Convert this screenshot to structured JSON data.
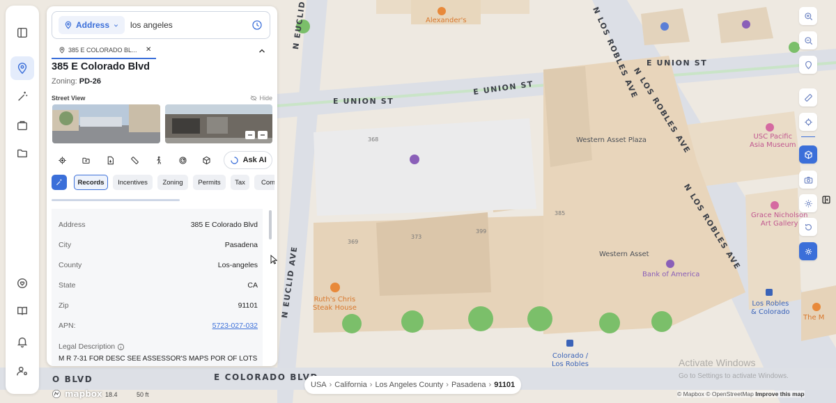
{
  "search": {
    "type_label": "Address",
    "value": "los angeles"
  },
  "tab": {
    "label": "385 E COLORADO BL..."
  },
  "property": {
    "title": "385 E Colorado Blvd",
    "zoning_label": "Zoning:",
    "zoning_value": "PD-26",
    "street_view_label": "Street View",
    "hide_label": "Hide",
    "ask_ai": "Ask AI"
  },
  "chips": [
    "Records",
    "Incentives",
    "Zoning",
    "Permits",
    "Tax",
    "Com"
  ],
  "records": [
    {
      "k": "Address",
      "v": "385 E Colorado Blvd"
    },
    {
      "k": "City",
      "v": "Pasadena"
    },
    {
      "k": "County",
      "v": "Los-angeles"
    },
    {
      "k": "State",
      "v": "CA"
    },
    {
      "k": "Zip",
      "v": "91101"
    },
    {
      "k": "APN:",
      "v": "5723-027-032"
    }
  ],
  "legal": {
    "label": "Legal Description",
    "text": "M R 7-31 FOR DESC SEE ASSESSOR'S MAPS POR OF LOTS"
  },
  "breadcrumb": [
    "USA",
    "California",
    "Los Angeles County",
    "Pasadena",
    "91101"
  ],
  "map": {
    "streets": {
      "euclid_top": "N EUCLID AVE",
      "euclid_bottom": "N EUCLID AVE",
      "union_1": "E UNION ST",
      "union_2": "E UNION ST",
      "union_3": "E UNION ST",
      "robles_top": "N LOS ROBLES AVE",
      "robles_mid": "N LOS ROBLES AVE",
      "robles_bottom": "N LOS ROBLES AVE",
      "colorado_left": "O BLVD",
      "colorado_right": "E COLORADO BLVD"
    },
    "pois": {
      "alexanders": "Alexander's",
      "western_asset_plaza": "Western Asset Plaza",
      "western_asset": "Western Asset",
      "bank_of_america": "Bank of America",
      "usc_pacific_1": "USC Pacific",
      "usc_pacific_2": "Asia Museum",
      "grace_1": "Grace Nicholson",
      "grace_2": "Art Gallery",
      "ruths_1": "Ruth's Chris",
      "ruths_2": "Steak House",
      "losrobles_1": "Los Robles",
      "losrobles_2": "& Colorado",
      "colorado_1": "Colorado /",
      "colorado_2": "Los Robles",
      "the_m": "The M"
    },
    "numbers": {
      "n368": "368",
      "n369": "369",
      "n373": "373",
      "n399": "399",
      "n385": "385"
    }
  },
  "footer": {
    "logo": "mapbox",
    "zoom": "18.4",
    "scale": "50 ft",
    "attribution_1": "© Mapbox © OpenStreetMap",
    "attribution_2": "Improve this map",
    "watermark_1": "Activate Windows",
    "watermark_2": "Go to Settings to activate Windows."
  }
}
